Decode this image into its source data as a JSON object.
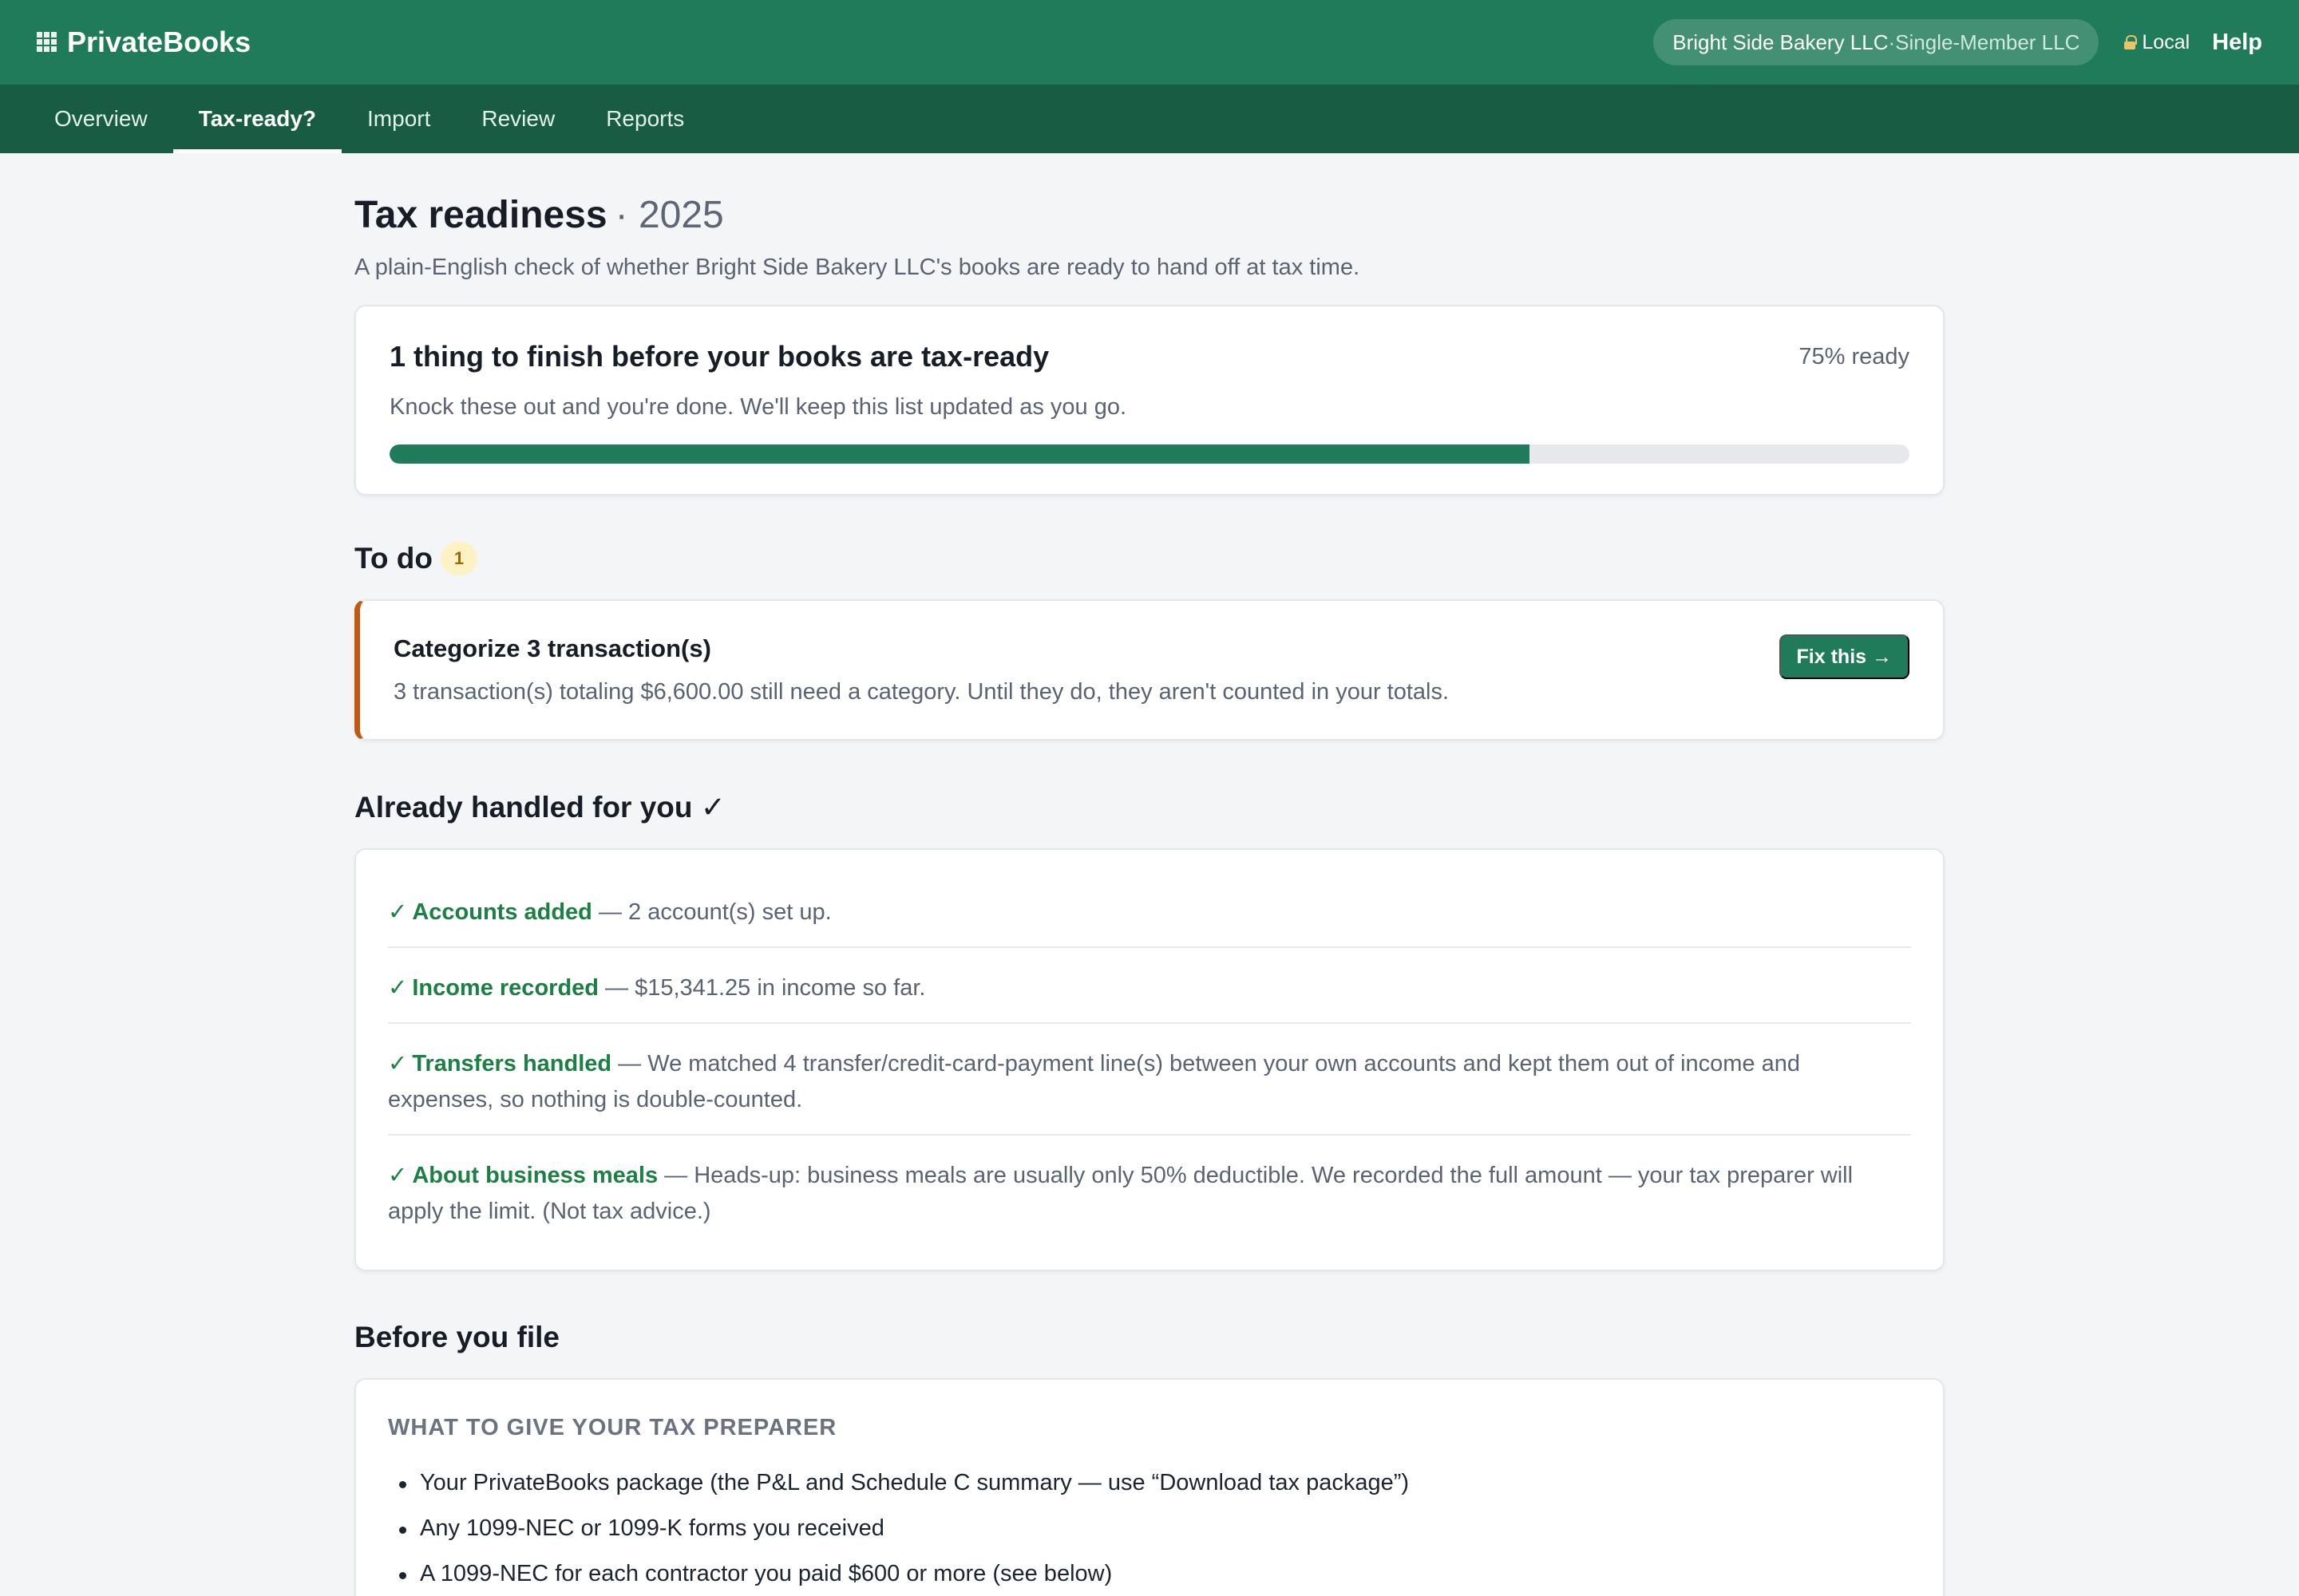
{
  "app": {
    "name": "PrivateBooks",
    "company": "Bright Side Bakery LLC",
    "company_separator": " · ",
    "company_type": "Single-Member LLC",
    "local_label": "Local",
    "help_label": "Help"
  },
  "tabs": [
    {
      "label": "Overview",
      "active": false
    },
    {
      "label": "Tax-ready?",
      "active": true
    },
    {
      "label": "Import",
      "active": false
    },
    {
      "label": "Review",
      "active": false
    },
    {
      "label": "Reports",
      "active": false
    }
  ],
  "page": {
    "title": "Tax readiness",
    "year": "· 2025",
    "subtitle": "A plain-English check of whether Bright Side Bakery LLC's books are ready to hand off at tax time."
  },
  "progress": {
    "title": "1 thing to finish before your books are tax-ready",
    "percent_label": "75% ready",
    "percent": 75,
    "description": "Knock these out and you're done. We'll keep this list updated as you go."
  },
  "todo": {
    "title": "To do",
    "count": "1",
    "items": [
      {
        "name": "Categorize 3 transaction(s)",
        "description": "3 transaction(s) totaling $6,600.00 still need a category. Until they do, they aren't counted in your totals.",
        "button_label": "Fix this →"
      }
    ]
  },
  "handled": {
    "title": "Already handled for you ✓",
    "items": [
      {
        "check": "✓",
        "name": "Accounts added",
        "text": " — 2 account(s) set up."
      },
      {
        "check": "✓",
        "name": "Income recorded",
        "text": " — $15,341.25 in income so far."
      },
      {
        "check": "✓",
        "name": "Transfers handled",
        "text": " — We matched 4 transfer/credit-card-payment line(s) between your own accounts and kept them out of income and expenses, so nothing is double-counted."
      },
      {
        "check": "✓",
        "name": "About business meals",
        "text": " — Heads-up: business meals are usually only 50% deductible. We recorded the full amount — your tax preparer will apply the limit. (Not tax advice.)"
      }
    ]
  },
  "before_file": {
    "title": "Before you file",
    "heading": "WHAT TO GIVE YOUR TAX PREPARER",
    "items": [
      "Your PrivateBooks package (the P&L and Schedule C summary — use “Download tax package”)",
      "Any 1099-NEC or 1099-K forms you received",
      "A 1099-NEC for each contractor you paid $600 or more (see below)"
    ]
  },
  "colors": {
    "brand": "#207b5a",
    "tabbar": "#175c43",
    "warning_accent": "#c05a12",
    "success": "#1c8044"
  }
}
